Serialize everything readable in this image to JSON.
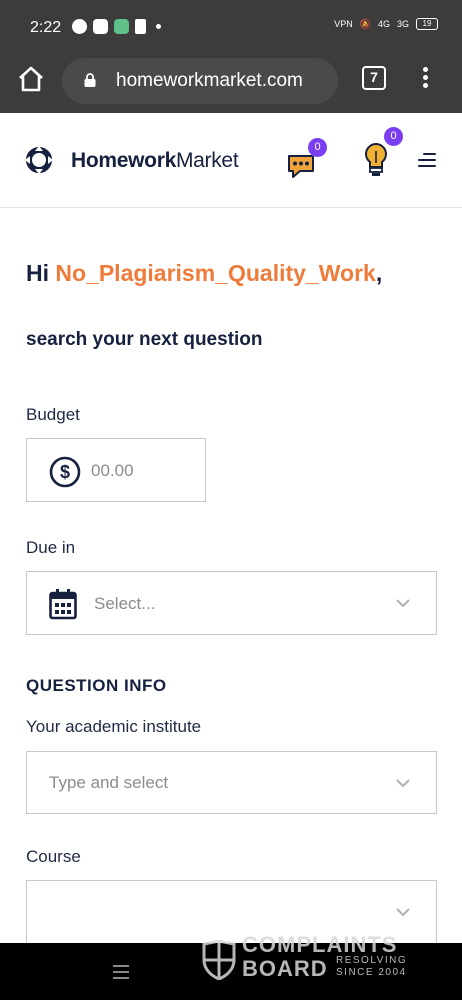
{
  "status_bar": {
    "time": "2:22",
    "battery": "19",
    "network_labels": [
      "VPN",
      "4G",
      "3G"
    ]
  },
  "browser": {
    "url": "homeworkmarket.com",
    "tab_count": "7"
  },
  "header": {
    "logo_bold": "Homework",
    "logo_light": "Market",
    "messages_count": "0",
    "notifications_count": "0"
  },
  "greeting": {
    "prefix": "Hi ",
    "username": "No_Plagiarism_Quality_Work",
    "suffix": ",",
    "subtitle": "search your next question"
  },
  "form": {
    "budget_label": "Budget",
    "budget_placeholder": "00.00",
    "due_label": "Due in",
    "due_placeholder": "Select...",
    "section_title": "QUESTION INFO",
    "institute_label": "Your academic institute",
    "institute_placeholder": "Type and select",
    "course_label": "Course",
    "course_placeholder": ""
  },
  "watermark": {
    "line1": "COMPLAINTS",
    "line2": "BOARD",
    "tagline1": "RESOLVING",
    "tagline2": "SINCE 2004"
  },
  "colors": {
    "brand_navy": "#16213f",
    "accent_orange": "#ef7b3a",
    "badge_purple": "#7b3ff2"
  },
  "icons": [
    "home-icon",
    "lock-icon",
    "tabs-icon",
    "more-vert-icon",
    "logo-icon",
    "chat-icon",
    "lightbulb-icon",
    "hamburger-icon",
    "dollar-icon",
    "calendar-icon",
    "chevron-down-icon"
  ]
}
